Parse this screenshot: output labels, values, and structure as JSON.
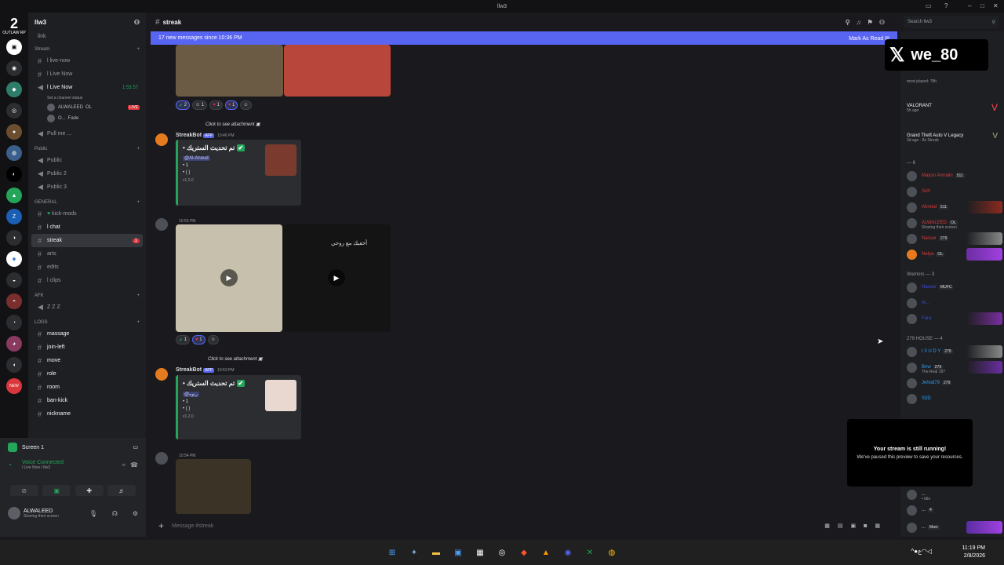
{
  "window": {
    "title": "llw3"
  },
  "server": {
    "name": "llw3",
    "logo_text": "OUTLAW RP"
  },
  "channels": {
    "link_label": "link",
    "categories": [
      {
        "name": "Stream",
        "items": [
          {
            "label": "l live-now"
          },
          {
            "label": "l Live Now"
          },
          {
            "label": "l Live Now",
            "timer": "1:53:57",
            "status": "Set a channel status"
          }
        ]
      },
      {
        "name": "Public",
        "items": [
          {
            "label": "Public"
          },
          {
            "label": "Public 2"
          },
          {
            "label": "Public 3"
          }
        ]
      },
      {
        "name": "GENERAL",
        "items": [
          {
            "label": "kick-mods"
          },
          {
            "label": "l chat"
          },
          {
            "label": "streak",
            "badge": "1"
          },
          {
            "label": "arts"
          },
          {
            "label": "edits"
          },
          {
            "label": "l clips"
          }
        ]
      },
      {
        "name": "AFK",
        "items": [
          {
            "label": "Z Z Z"
          }
        ]
      },
      {
        "name": "LOGS",
        "items": [
          {
            "label": "massage"
          },
          {
            "label": "join-left"
          },
          {
            "label": "move"
          },
          {
            "label": "role"
          },
          {
            "label": "room"
          },
          {
            "label": "ban-kick"
          },
          {
            "label": "nickname"
          }
        ]
      }
    ],
    "voice_users": [
      {
        "name": "ALWALEED",
        "tag": "OL",
        "live": "LIVE"
      },
      {
        "name": "O...",
        "tag": "Fade"
      }
    ],
    "pull_me": "Pull me ..."
  },
  "voice_panel": {
    "screen": "Screen 1",
    "status": "Voice Connected",
    "sub": "l Live Now / llw3",
    "user": "ALWALEED",
    "user_sub": "Sharing their screen"
  },
  "chat": {
    "channel": "streak",
    "banner": "17 new messages since 10:36 PM",
    "mark_read": "Mark As Read",
    "reactions1": [
      "2",
      "1",
      "1",
      "1"
    ],
    "bot_name": "StreakBot",
    "app_tag": "APP",
    "attach_hint": "Click to see attachment",
    "msg1": {
      "time": "10:46 PM",
      "title": "تم تحديث الستريك •",
      "mention": "@Al-Anoud",
      "line1": "• 1",
      "line2": "• ( )",
      "version": "v1.2.0"
    },
    "msg2": {
      "time": "10:53 PM",
      "overlay": "أخفيك مع روحي",
      "reactions": [
        "1",
        "1"
      ]
    },
    "msg3": {
      "time": "10:53 PM",
      "title": "تم تحديث الستريك •",
      "mention": "@رتوه",
      "line1": "• 1",
      "line2": "• ( )",
      "version": "v1.2.0"
    },
    "msg4": {
      "time": "10:54 PM"
    },
    "composer_placeholder": "Message #streak",
    "search_placeholder": "Search llw3"
  },
  "members": {
    "games": [
      {
        "name": "most played: 78h",
        "sub": ""
      },
      {
        "name": "VALORANT",
        "sub": "5h ago"
      },
      {
        "name": "Grand Theft Auto V Legacy",
        "sub": "3d ago · 8x Streak"
      }
    ],
    "group1": {
      "title": "— 6",
      "members": [
        {
          "name": "Mayon Amralin",
          "tag": "511",
          "color": "#d83c3e"
        },
        {
          "name": "Soh",
          "tag": "",
          "color": "#d83c3e"
        },
        {
          "name": "Ahmed",
          "tag": "511",
          "color": "#d83c3e"
        },
        {
          "name": "ALWALEED",
          "tag": "OL",
          "color": "#d83c3e",
          "sub": "Sharing their screen"
        },
        {
          "name": "Nasser",
          "tag": "279",
          "color": "#d83c3e"
        },
        {
          "name": "Nelya",
          "tag": "OL",
          "color": "#d83c3e"
        }
      ]
    },
    "group2": {
      "title": "Warriors — 3",
      "members": [
        {
          "name": "Nasser",
          "tag": "MUFC",
          "color": "#3b4adf"
        },
        {
          "name": "Al...",
          "tag": "",
          "color": "#3b4adf"
        },
        {
          "name": "Fara",
          "tag": "",
          "color": "#3b4adf"
        }
      ]
    },
    "group3": {
      "title": "279 HOUSE — 4",
      "members": [
        {
          "name": "I 3 U D Y",
          "tag": "279",
          "color": "#2b9ef5"
        },
        {
          "name": "Bnw",
          "tag": "279",
          "color": "#2b9ef5",
          "sub": "The Real 187"
        },
        {
          "name": "Jehod79",
          "tag": "279",
          "color": "#2b9ef5"
        },
        {
          "name": "S3D",
          "tag": "",
          "color": "#2b9ef5"
        }
      ]
    },
    "bottom": [
      {
        "name": "...",
        "sub": "• Idle",
        "tag": ""
      },
      {
        "name": "...",
        "tag": "4"
      },
      {
        "name": "...",
        "tag": "Mavi"
      }
    ]
  },
  "toast": {
    "title": "Your stream is still running!",
    "body": "We've paused this preview to save your resources."
  },
  "x_handle": "we_80",
  "taskbar": {
    "time": "11:19 PM",
    "date": "2/8/2026",
    "lang": "ع"
  },
  "colors": {
    "accent": "#5865f2",
    "embed_bar": "#23a55a"
  }
}
